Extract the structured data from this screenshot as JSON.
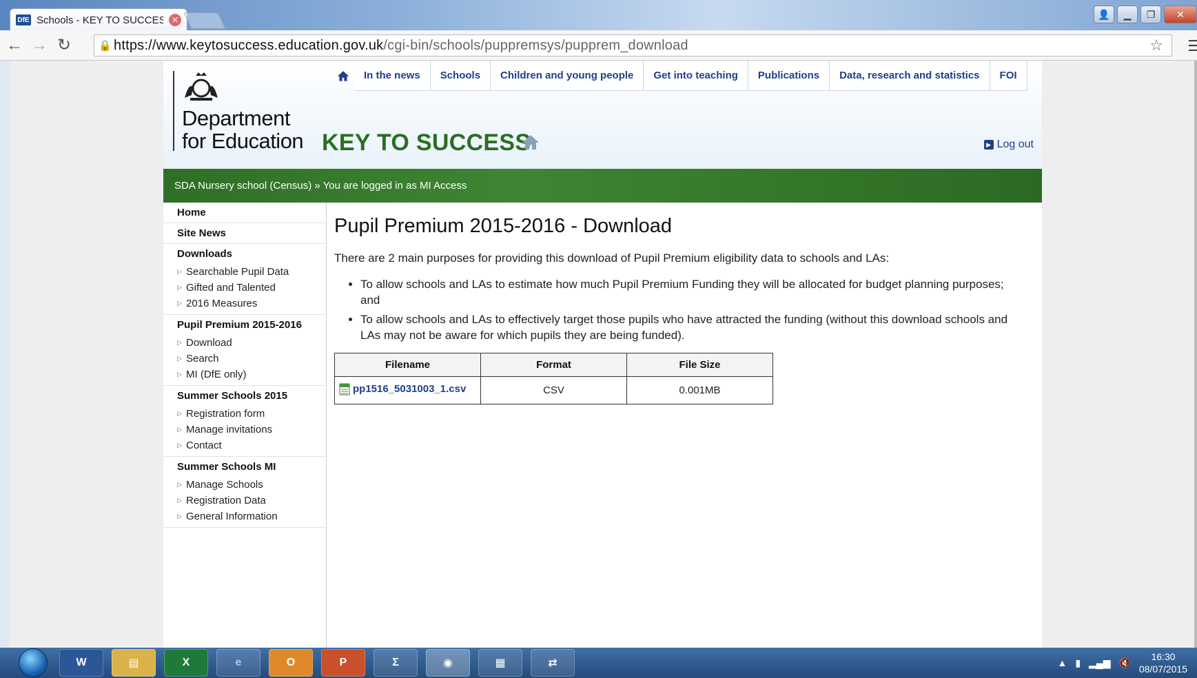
{
  "browser": {
    "tab_title": "Schools - KEY TO SUCCES",
    "tab_favicon": "DfE",
    "url_host": "https://www.keytosuccess.education.gov.uk",
    "url_path": "/cgi-bin/schools/puppremsys/pupprem_download"
  },
  "header": {
    "dept_line1": "Department",
    "dept_line2": "for Education",
    "site_title": "KEY TO SUCCESS",
    "logout": "Log out"
  },
  "topnav": [
    "In the news",
    "Schools",
    "Children and young people",
    "Get into teaching",
    "Publications",
    "Data, research and statistics",
    "FOI"
  ],
  "status_bar": "SDA Nursery school (Census) » You are logged in as MI Access",
  "sidebar": {
    "home": "Home",
    "site_news": "Site News",
    "downloads": {
      "title": "Downloads",
      "links": [
        "Searchable Pupil Data",
        "Gifted and Talented",
        "2016 Measures"
      ]
    },
    "pupil_premium": {
      "title": "Pupil Premium 2015-2016",
      "links": [
        "Download",
        "Search",
        "MI (DfE only)"
      ]
    },
    "summer_schools": {
      "title": "Summer Schools 2015",
      "links": [
        "Registration form",
        "Manage invitations",
        "Contact"
      ]
    },
    "summer_schools_mi": {
      "title": "Summer Schools MI",
      "links": [
        "Manage Schools",
        "Registration Data",
        "General Information"
      ]
    }
  },
  "main": {
    "title": "Pupil Premium 2015-2016 - Download",
    "intro": "There are 2 main purposes for providing this download of Pupil Premium eligibility data to schools and LAs:",
    "purposes": [
      "To allow schools and LAs to estimate how much Pupil Premium Funding they will be allocated for budget planning purposes; and",
      "To allow schools and LAs to effectively target those pupils who have attracted the funding (without this download schools and LAs may not be aware for which pupils they are being funded)."
    ],
    "table": {
      "headers": [
        "Filename",
        "Format",
        "File Size"
      ],
      "rows": [
        {
          "filename": "pp1516_5031003_1.csv",
          "format": "CSV",
          "size": "0.001MB"
        }
      ]
    }
  },
  "taskbar": {
    "time": "16:30",
    "date": "08/07/2015"
  },
  "colors": {
    "brand_green": "#2e6f25",
    "link_blue": "#1e3f8c"
  }
}
